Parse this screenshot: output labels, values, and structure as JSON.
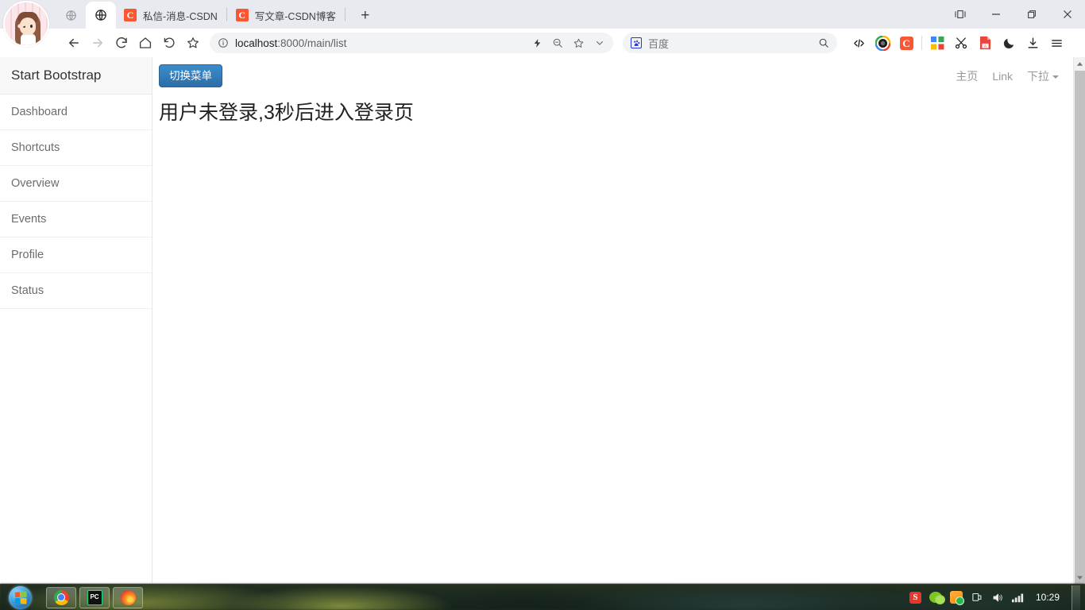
{
  "browser": {
    "tabs": [
      {
        "id": "pinned-1",
        "label": "",
        "icon": "globe-gray-icon",
        "pinned": true,
        "active": false
      },
      {
        "id": "pinned-2",
        "label": "",
        "icon": "globe-icon",
        "pinned": true,
        "active": true
      },
      {
        "id": "tab-csdn-message",
        "label": "私信-消息-CSDN",
        "icon": "csdn-icon",
        "pinned": false,
        "active": false
      },
      {
        "id": "tab-csdn-write",
        "label": "写文章-CSDN博客",
        "icon": "csdn-icon",
        "pinned": false,
        "active": false
      }
    ],
    "new_tab_label": "+",
    "window_controls": {
      "split_label": "⫿▢⫿",
      "minimize_label": "—",
      "maximize_label": "❐",
      "close_label": "✕"
    },
    "toolbar": {
      "back_label": "←",
      "forward_label": "→",
      "reload_label": "⟳",
      "home_label": "⌂",
      "history_label": "↺",
      "bookmark_label": "☆"
    },
    "omnibox": {
      "site_info_icon": "info-circle-icon",
      "url_main": "localhost",
      "url_rest": ":8000/main/list",
      "url_full": "localhost:8000/main/list",
      "right_icons": [
        "lightning-icon",
        "zoom-out-icon",
        "star-icon",
        "chevron-down-icon"
      ]
    },
    "search": {
      "engine": "baidu",
      "placeholder": "百度",
      "search_icon": "search-icon"
    },
    "extensions": [
      {
        "name": "code-icon",
        "label": "</>"
      },
      {
        "name": "camera-ring-icon",
        "label": ""
      },
      {
        "name": "csdn-extension-icon",
        "label": "C"
      },
      {
        "name": "apps-grid-icon",
        "label": ""
      },
      {
        "name": "scissors-icon",
        "label": "✂"
      },
      {
        "name": "pdf-icon",
        "label": ""
      },
      {
        "name": "dark-mode-icon",
        "label": "☾"
      },
      {
        "name": "download-icon",
        "label": "⤓"
      },
      {
        "name": "menu-icon",
        "label": "☰"
      }
    ]
  },
  "page": {
    "sidebar": {
      "brand": "Start Bootstrap",
      "items": [
        {
          "label": "Dashboard"
        },
        {
          "label": "Shortcuts"
        },
        {
          "label": "Overview"
        },
        {
          "label": "Events"
        },
        {
          "label": "Profile"
        },
        {
          "label": "Status"
        }
      ]
    },
    "topnav": {
      "toggle_label": "切换菜单",
      "links": [
        {
          "label": "主页",
          "dropdown": false
        },
        {
          "label": "Link",
          "dropdown": false
        },
        {
          "label": "下拉",
          "dropdown": true
        }
      ]
    },
    "main": {
      "message": "用户未登录,3秒后进入登录页"
    },
    "accent_color": "#3c8dcd"
  },
  "taskbar": {
    "start_label": "Start",
    "tasks": [
      {
        "name": "chrome",
        "label": "Google Chrome"
      },
      {
        "name": "pycharm",
        "label": "PC"
      },
      {
        "name": "firefox",
        "label": "Firefox"
      }
    ],
    "tray": [
      {
        "name": "sogou-input-icon",
        "label": "S"
      },
      {
        "name": "wechat-icon",
        "label": ""
      },
      {
        "name": "orange-app-icon",
        "label": ""
      },
      {
        "name": "power-plug-icon",
        "label": ""
      },
      {
        "name": "volume-icon",
        "label": ""
      },
      {
        "name": "network-signal-icon",
        "label": ""
      }
    ],
    "clock": "10:29"
  }
}
